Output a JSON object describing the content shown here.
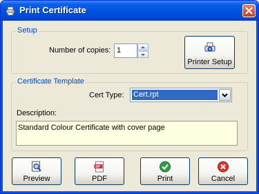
{
  "window": {
    "title": "Print Certificate"
  },
  "setup": {
    "legend": "Setup",
    "copies_label": "Number of copies:",
    "copies_value": "1",
    "printer_setup_label": "Printer Setup"
  },
  "template": {
    "legend": "Certificate Template",
    "cert_type_label": "Cert Type:",
    "cert_type_value": "Cert.rpt",
    "description_label": "Description:",
    "description_value": "Standard Colour Certificate with cover page"
  },
  "buttons": {
    "preview": "Preview",
    "pdf": "PDF",
    "print": "Print",
    "cancel": "Cancel"
  },
  "colors": {
    "titlebar": "#0054E3",
    "legend_text": "#0046D5",
    "description_bg": "#FFFFE1",
    "select_highlight": "#316AC5"
  }
}
